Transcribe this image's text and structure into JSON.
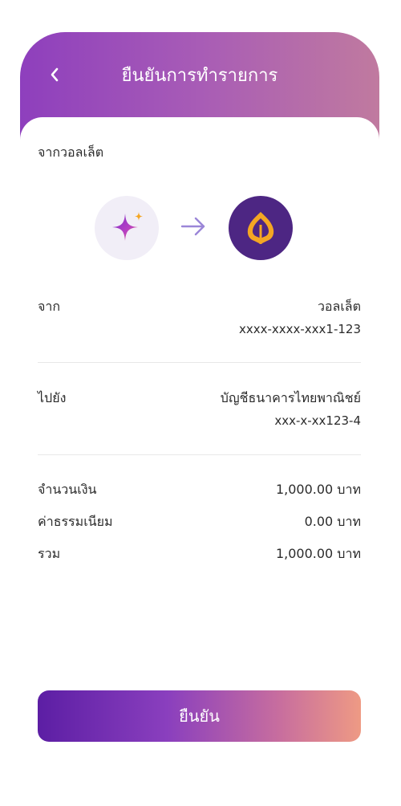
{
  "header": {
    "title": "ยืนยันการทำรายการ",
    "back_icon": "chevron-left-icon"
  },
  "source": {
    "section_label": "จากวอลเล็ต"
  },
  "icons": {
    "wallet": "sparkle-icon",
    "arrow": "arrow-right-icon",
    "bank": "bank-logo-icon"
  },
  "from": {
    "label": "จาก",
    "name": "วอลเล็ต",
    "account": "xxxx-xxxx-xxx1-123"
  },
  "to": {
    "label": "ไปยัง",
    "name": "บัญชีธนาคารไทยพาณิชย์",
    "account": "xxx-x-xx123-4"
  },
  "amounts": {
    "amount_label": "จำนวนเงิน",
    "amount_value": "1,000.00 บาท",
    "fee_label": "ค่าธรรมเนียม",
    "fee_value": "0.00 บาท",
    "total_label": "รวม",
    "total_value": "1,000.00 บาท"
  },
  "confirm_label": "ยืนยัน",
  "colors": {
    "brand_purple": "#8e3fbd",
    "bank_purple": "#4d2683",
    "bank_gold": "#f4a623",
    "arrow": "#9b86d8"
  }
}
